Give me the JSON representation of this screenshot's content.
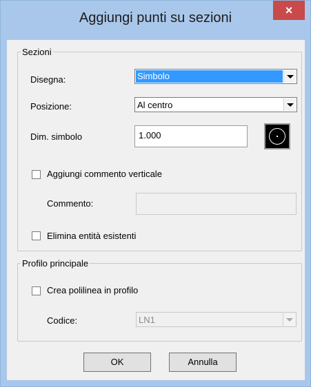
{
  "window": {
    "title": "Aggiungi punti su sezioni",
    "close_label": "×"
  },
  "sezioni": {
    "legend": "Sezioni",
    "disegna": {
      "label": "Disegna:",
      "value": "Simbolo"
    },
    "posizione": {
      "label": "Posizione:",
      "value": "Al centro"
    },
    "dim_simbolo": {
      "label": "Dim. simbolo",
      "value": "1.000",
      "symbol_icon": "circle-symbol-icon"
    },
    "aggiungi_commento": {
      "label": "Aggiungi commento verticale",
      "checked": false
    },
    "commento": {
      "label": "Commento:",
      "value": ""
    },
    "elimina_entita": {
      "label": "Elimina entità esistenti",
      "checked": false
    }
  },
  "profilo": {
    "legend": "Profilo principale",
    "crea_polilinea": {
      "label": "Crea polilinea in profilo",
      "checked": false
    },
    "codice": {
      "label": "Codice:",
      "value": "LN1"
    }
  },
  "buttons": {
    "ok": "OK",
    "cancel": "Annulla"
  },
  "colors": {
    "titlebar": "#a9c7ea",
    "close": "#c94a4a",
    "selection": "#3399ff"
  }
}
